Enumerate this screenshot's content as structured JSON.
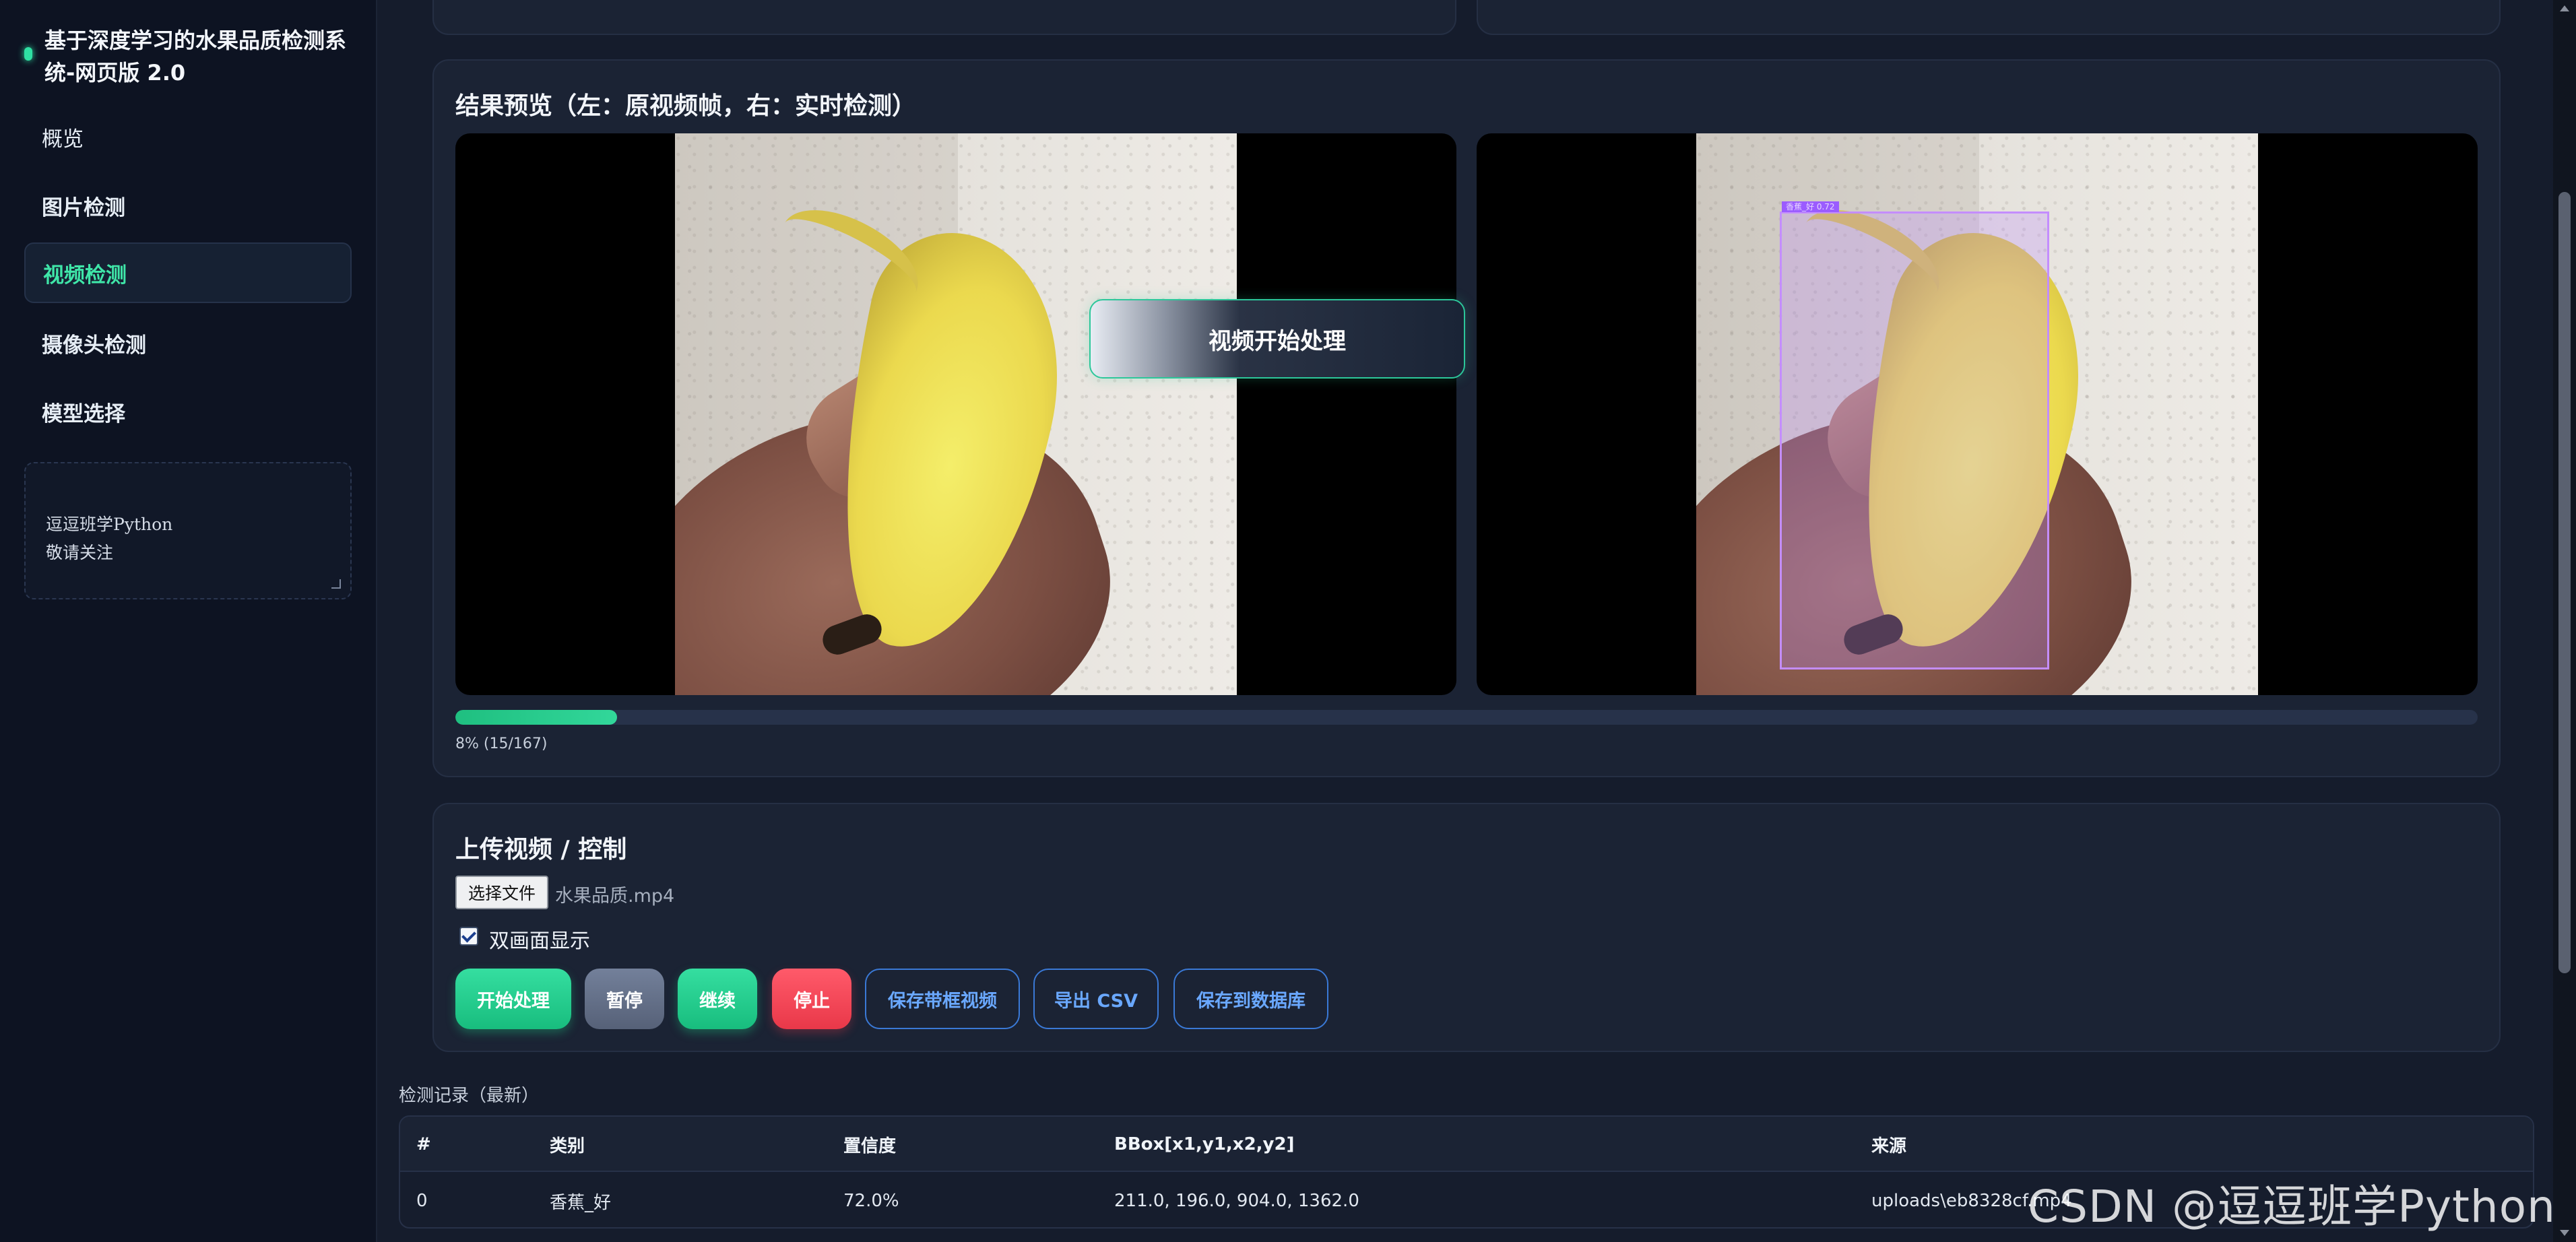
{
  "sidebar": {
    "brand_title": "基于深度学习的水果品质检测系统-网页版 2.0",
    "nav": [
      {
        "label": "概览"
      },
      {
        "label": "图片检测"
      },
      {
        "label": "视频检测"
      },
      {
        "label": "摄像头检测"
      },
      {
        "label": "模型选择"
      }
    ],
    "active_index": 2,
    "note_text": "逗逗班学Python\n敬请关注"
  },
  "preview": {
    "title": "结果预览（左：原视频帧，右：实时检测）",
    "toast": "视频开始处理",
    "bbox_label": "香蕉_好 0.72",
    "progress_fraction": 0.08,
    "progress_text": "8% (15/167)"
  },
  "upload": {
    "title": "上传视频 / 控制",
    "file_button": "选择文件",
    "file_name": "水果品质.mp4",
    "dual_label": "双画面显示",
    "dual_checked": true,
    "buttons": {
      "start": "开始处理",
      "pause": "暂停",
      "resume": "继续",
      "stop": "停止",
      "save_video": "保存带框视频",
      "export_csv": "导出 CSV",
      "save_db": "保存到数据库"
    }
  },
  "records": {
    "title": "检测记录（最新）",
    "columns": [
      "#",
      "类别",
      "置信度",
      "BBox[x1,y1,x2,y2]",
      "来源"
    ],
    "rows": [
      [
        "0",
        "香蕉_好",
        "72.0%",
        "211.0, 196.0, 904.0, 1362.0",
        "uploads\\eb8328cf.mp4"
      ]
    ]
  },
  "watermark": "CSDN @逗逗班学Python",
  "colors": {
    "accent_green": "#2fe0a3",
    "danger_red": "#e93849",
    "outline_blue": "#3a79d6",
    "bbox_purple": "#c48dff"
  }
}
